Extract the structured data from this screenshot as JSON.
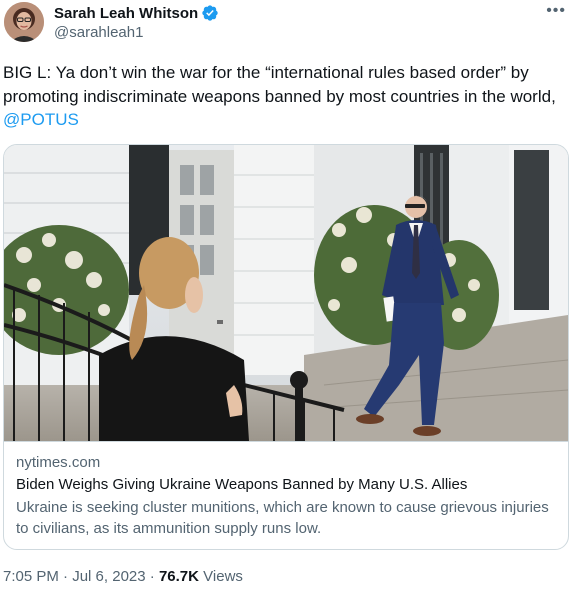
{
  "author": {
    "display_name": "Sarah Leah Whitson",
    "handle": "@sarahleah1",
    "verified": true
  },
  "more_icon": "•••",
  "tweet": {
    "text": "BIG L: Ya don’t win the war for the “international rules based order” by promoting indiscriminate weapons banned by most countries in the world, ",
    "mention": "@POTUS"
  },
  "card": {
    "domain": "nytimes.com",
    "title": "Biden Weighs Giving Ukraine Weapons Banned by Many U.S. Allies",
    "description": "Ukraine is seeking cluster munitions, which are known to cause grievous injuries to civilians, as its ammunition supply runs low."
  },
  "meta": {
    "time": "7:05 PM",
    "date": "Jul 6, 2023",
    "separator": "·",
    "views_count": "76.7K",
    "views_label": "Views"
  },
  "colors": {
    "link": "#1d9bf0",
    "secondary_text": "#536471",
    "primary_text": "#0f1419",
    "border": "#cfd9de",
    "verified_badge": "#1d9bf0"
  }
}
